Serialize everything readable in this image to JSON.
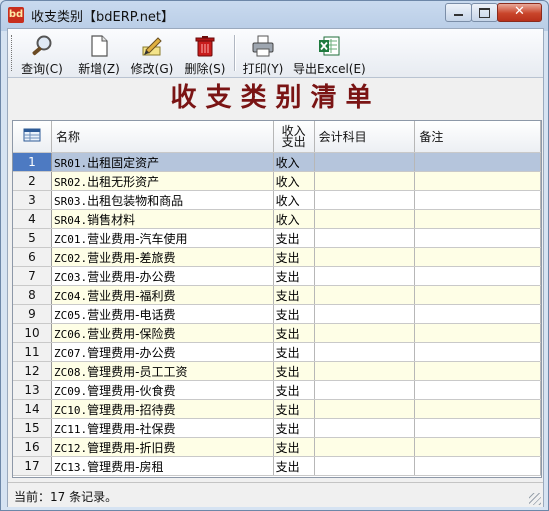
{
  "window": {
    "title": "收支类别【bdERP.net】",
    "app_icon_text": "bd"
  },
  "toolbar": {
    "items": [
      {
        "label": "查询(C)",
        "icon": "search-icon"
      },
      {
        "label": "新增(Z)",
        "icon": "new-document-icon"
      },
      {
        "label": "修改(G)",
        "icon": "edit-icon"
      },
      {
        "label": "删除(S)",
        "icon": "trash-icon"
      },
      {
        "label": "打印(Y)",
        "icon": "printer-icon"
      },
      {
        "label": "导出Excel(E)",
        "icon": "excel-icon"
      }
    ]
  },
  "banner": {
    "title": "收支类别清单"
  },
  "grid": {
    "columns": {
      "name": "名称",
      "income_expense": "收入\n支出",
      "account": "会计科目",
      "note": "备注"
    },
    "rows": [
      {
        "num": "1",
        "code": "SR01.",
        "name": "出租固定资产",
        "type": "收入"
      },
      {
        "num": "2",
        "code": "SR02.",
        "name": "出租无形资产",
        "type": "收入"
      },
      {
        "num": "3",
        "code": "SR03.",
        "name": "出租包装物和商品",
        "type": "收入"
      },
      {
        "num": "4",
        "code": "SR04.",
        "name": "销售材料",
        "type": "收入"
      },
      {
        "num": "5",
        "code": "ZC01.",
        "name": "营业费用-汽车使用",
        "type": "支出"
      },
      {
        "num": "6",
        "code": "ZC02.",
        "name": "营业费用-差旅费",
        "type": "支出"
      },
      {
        "num": "7",
        "code": "ZC03.",
        "name": "营业费用-办公费",
        "type": "支出"
      },
      {
        "num": "8",
        "code": "ZC04.",
        "name": "营业费用-福利费",
        "type": "支出"
      },
      {
        "num": "9",
        "code": "ZC05.",
        "name": "营业费用-电话费",
        "type": "支出"
      },
      {
        "num": "10",
        "code": "ZC06.",
        "name": "营业费用-保险费",
        "type": "支出"
      },
      {
        "num": "11",
        "code": "ZC07.",
        "name": "管理费用-办公费",
        "type": "支出"
      },
      {
        "num": "12",
        "code": "ZC08.",
        "name": "管理费用-员工工资",
        "type": "支出"
      },
      {
        "num": "13",
        "code": "ZC09.",
        "name": "管理费用-伙食费",
        "type": "支出"
      },
      {
        "num": "14",
        "code": "ZC10.",
        "name": "管理费用-招待费",
        "type": "支出"
      },
      {
        "num": "15",
        "code": "ZC11.",
        "name": "管理费用-社保费",
        "type": "支出"
      },
      {
        "num": "16",
        "code": "ZC12.",
        "name": "管理费用-折旧费",
        "type": "支出"
      },
      {
        "num": "17",
        "code": "ZC13.",
        "name": "管理费用-房租",
        "type": "支出"
      }
    ],
    "selected_row": "1"
  },
  "status": {
    "text": "当前：17 条记录。"
  },
  "colors": {
    "banner": "#7a1414",
    "selected_row": "#b5c5dc",
    "alt_row": "#fefee6"
  }
}
